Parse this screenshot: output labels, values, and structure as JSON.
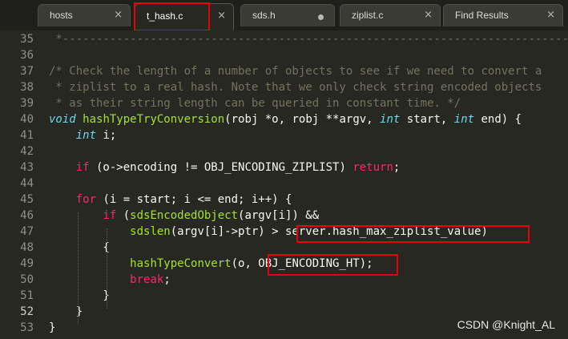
{
  "tabs": [
    {
      "label": "hosts",
      "state": "close"
    },
    {
      "label": "t_hash.c",
      "state": "close"
    },
    {
      "label": "sds.h",
      "state": "modified"
    },
    {
      "label": "ziplist.c",
      "state": "close"
    },
    {
      "label": "Find Results",
      "state": "close"
    }
  ],
  "close_glyph": "×",
  "active_tab": "t_hash.c",
  "current_line": "52",
  "colors": {
    "background": "#272822",
    "comment": "#75715e",
    "keyword": "#f92672",
    "type": "#66d9ef",
    "function": "#a6e22e",
    "text": "#f8f8f2",
    "annotation": "#e8000b"
  },
  "lines": [
    {
      "num": "35",
      "tokens": [
        {
          "c": "cm",
          "t": " *-------------------------------------------------------------------------------"
        }
      ]
    },
    {
      "num": "36",
      "tokens": []
    },
    {
      "num": "37",
      "tokens": [
        {
          "c": "cm",
          "t": "/* Check the length of a number of objects to see if we need to convert a"
        }
      ]
    },
    {
      "num": "38",
      "tokens": [
        {
          "c": "cm",
          "t": " * ziplist to a real hash. Note that we only check string encoded objects"
        }
      ]
    },
    {
      "num": "39",
      "tokens": [
        {
          "c": "cm",
          "t": " * as their string length can be queried in constant time. */"
        }
      ]
    },
    {
      "num": "40",
      "tokens": [
        {
          "c": "ty",
          "t": "void"
        },
        {
          "c": "",
          "t": " "
        },
        {
          "c": "fn",
          "t": "hashTypeTryConversion"
        },
        {
          "c": "",
          "t": "(robj *o, robj **argv, "
        },
        {
          "c": "ty",
          "t": "int"
        },
        {
          "c": "",
          "t": " start, "
        },
        {
          "c": "ty",
          "t": "int"
        },
        {
          "c": "",
          "t": " end) {"
        }
      ]
    },
    {
      "num": "41",
      "tokens": [
        {
          "c": "",
          "t": "    "
        },
        {
          "c": "ty",
          "t": "int"
        },
        {
          "c": "",
          "t": " i;"
        }
      ]
    },
    {
      "num": "42",
      "tokens": []
    },
    {
      "num": "43",
      "tokens": [
        {
          "c": "",
          "t": "    "
        },
        {
          "c": "kw",
          "t": "if"
        },
        {
          "c": "",
          "t": " (o->encoding != OBJ_ENCODING_ZIPLIST) "
        },
        {
          "c": "kw",
          "t": "return"
        },
        {
          "c": "",
          "t": ";"
        }
      ]
    },
    {
      "num": "44",
      "tokens": []
    },
    {
      "num": "45",
      "tokens": [
        {
          "c": "",
          "t": "    "
        },
        {
          "c": "kw",
          "t": "for"
        },
        {
          "c": "",
          "t": " (i = start; i <= end; i++) {"
        }
      ]
    },
    {
      "num": "46",
      "tokens": [
        {
          "c": "",
          "t": "        "
        },
        {
          "c": "kw",
          "t": "if"
        },
        {
          "c": "",
          "t": " ("
        },
        {
          "c": "fn",
          "t": "sdsEncodedObject"
        },
        {
          "c": "",
          "t": "(argv[i]) &&"
        }
      ]
    },
    {
      "num": "47",
      "tokens": [
        {
          "c": "",
          "t": "            "
        },
        {
          "c": "fn",
          "t": "sdslen"
        },
        {
          "c": "",
          "t": "(argv[i]->ptr) > server.hash_max_ziplist_value)"
        }
      ]
    },
    {
      "num": "48",
      "tokens": [
        {
          "c": "",
          "t": "        {"
        }
      ]
    },
    {
      "num": "49",
      "tokens": [
        {
          "c": "",
          "t": "            "
        },
        {
          "c": "fn",
          "t": "hashTypeConvert"
        },
        {
          "c": "",
          "t": "(o, OBJ_ENCODING_HT);"
        }
      ]
    },
    {
      "num": "50",
      "tokens": [
        {
          "c": "",
          "t": "            "
        },
        {
          "c": "kw",
          "t": "break"
        },
        {
          "c": "",
          "t": ";"
        }
      ]
    },
    {
      "num": "51",
      "tokens": [
        {
          "c": "",
          "t": "        }"
        }
      ]
    },
    {
      "num": "52",
      "tokens": [
        {
          "c": "",
          "t": "    }"
        }
      ]
    },
    {
      "num": "53",
      "tokens": [
        {
          "c": "",
          "t": "}"
        }
      ]
    }
  ],
  "watermark": "CSDN @Knight_AL"
}
